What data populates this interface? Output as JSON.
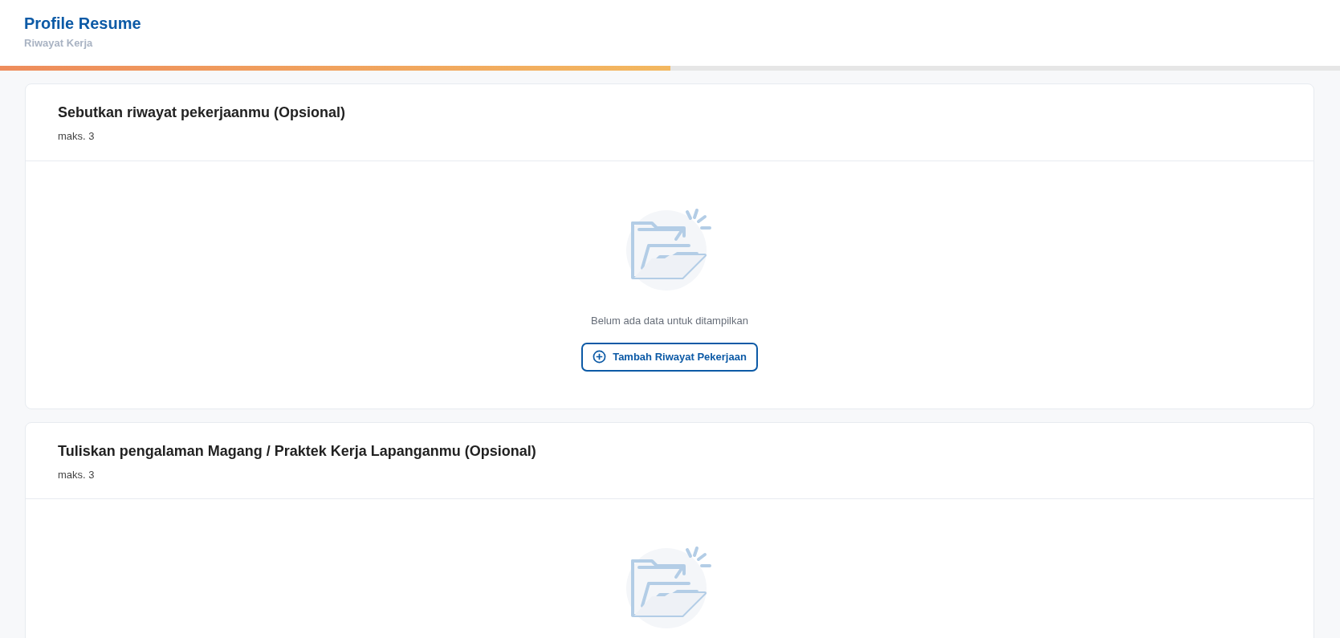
{
  "header": {
    "title": "Profile Resume",
    "subtitle": "Riwayat Kerja"
  },
  "progress": {
    "level": 0.5
  },
  "sections": [
    {
      "title": "Sebutkan riwayat pekerjaanmu (Opsional)",
      "note": "maks. 3",
      "empty_text": "Belum ada data untuk ditampilkan",
      "button": "Tambah Riwayat Pekerjaan"
    },
    {
      "title": "Tuliskan pengalaman Magang / Praktek Kerja Lapanganmu (Opsional)",
      "note": "maks. 3"
    }
  ]
}
